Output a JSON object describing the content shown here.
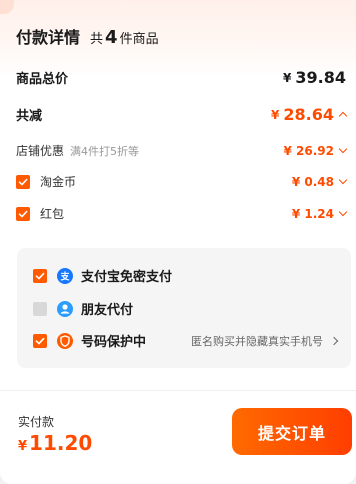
{
  "header": {
    "title": "付款详情",
    "count_prefix": "共",
    "count": "4",
    "count_suffix": "件商品"
  },
  "summary": {
    "total_label": "商品总价",
    "total_currency": "¥",
    "total_value": "39.84",
    "reduce_label": "共减",
    "reduce_currency": "¥",
    "reduce_value": "28.64"
  },
  "discounts": [
    {
      "label": "店铺优惠",
      "note": "满4件打5折等",
      "value": "¥ 26.92",
      "checked": null
    },
    {
      "label": "淘金币",
      "note": "",
      "value": "¥ 0.48",
      "checked": true
    },
    {
      "label": "红包",
      "note": "",
      "value": "¥ 1.24",
      "checked": true
    }
  ],
  "payment_options": [
    {
      "label": "支付宝免密支付",
      "checked": true,
      "icon": "alipay-icon",
      "hint": ""
    },
    {
      "label": "朋友代付",
      "checked": false,
      "icon": "friend-pay-icon",
      "hint": ""
    },
    {
      "label": "号码保护中",
      "checked": true,
      "icon": "phone-protect-icon",
      "hint": "匿名购买并隐藏真实手机号"
    }
  ],
  "footer": {
    "actual_label": "实付款",
    "actual_currency": "¥",
    "actual_value": "11.20",
    "submit_label": "提交订单"
  },
  "colors": {
    "accent": "#ff4b00",
    "alipay": "#1677ff",
    "friend": "#2c9cff",
    "protect": "#ff5a00"
  }
}
